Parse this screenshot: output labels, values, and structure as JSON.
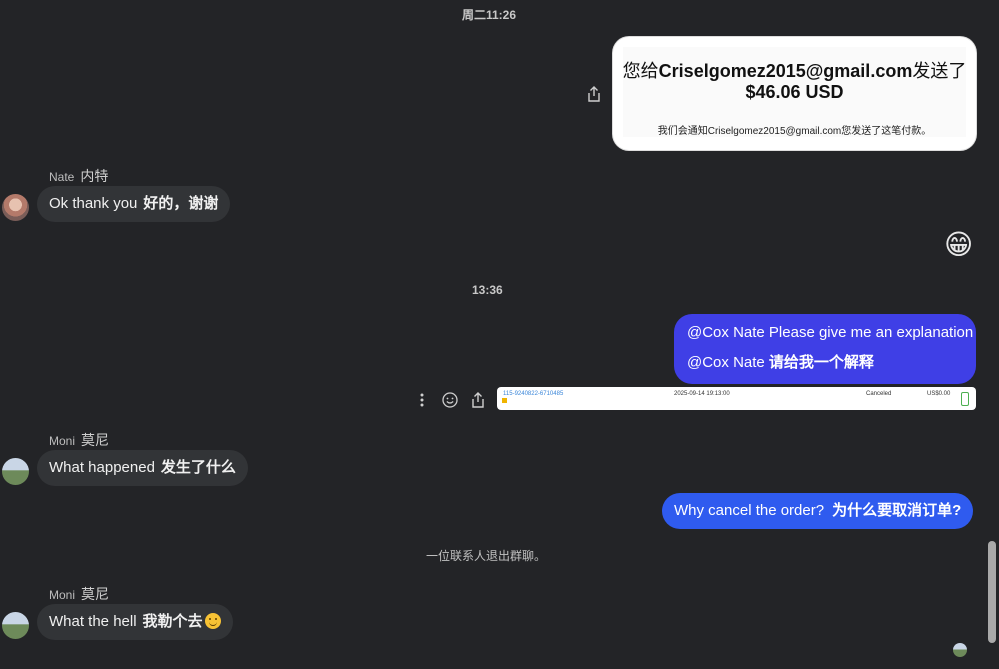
{
  "timestamps": {
    "first": "周二11:26",
    "second": "13:36"
  },
  "payment": {
    "line_prefix": "您给",
    "email": "Criselgomez2015@gmail.com",
    "line_suffix": "发送了",
    "amount": "$46.06 USD",
    "note": "我们会通知Criselgomez2015@gmail.com您发送了这笔付款。"
  },
  "messages": [
    {
      "sender_en": "Nate",
      "sender_cn": "内特",
      "text_en": "Ok thank you",
      "text_cn": "好的，谢谢"
    },
    {
      "sender_en": "Moni",
      "sender_cn": "莫尼",
      "text_en": "What happened",
      "text_cn": "发生了什么"
    },
    {
      "sender_en": "Moni",
      "sender_cn": "莫尼",
      "text_en": "What the hell",
      "text_cn": "我勒个去"
    }
  ],
  "emoji_reaction": "😁",
  "outgoing": {
    "explain_en": "@Cox Nate Please give me an explanation",
    "explain_cn_prefix": "@Cox Nate ",
    "explain_cn": "请给我一个解释",
    "cancel_en": "Why cancel the order?",
    "cancel_cn": "为什么要取消订单?"
  },
  "order_strip": {
    "id": "115-9240822-6710485",
    "date": "2025-09-14 19:13:00",
    "status": "Canceled",
    "amount": "US$0.00"
  },
  "system_notice": "一位联系人退出群聊。",
  "colors": {
    "background": "#232427",
    "incoming_bubble": "#323437",
    "outgoing_bubble": "#3f3fe6",
    "cancel_bubble": "#2f5bef"
  }
}
